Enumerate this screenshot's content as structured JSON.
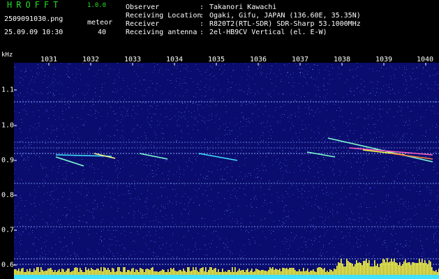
{
  "app": {
    "title": "HROFFT",
    "version": "1.0.0",
    "file_name": "2509091030.png",
    "timestamp": "25.09.09 10:30",
    "meteor_label": "meteor",
    "meteor_count": "40"
  },
  "info": [
    {
      "key": "Observer",
      "value": "Takanori Kawachi"
    },
    {
      "key": "Receiving Location",
      "value": "Ogaki, Gifu, JAPAN (136.60E, 35.35N)"
    },
    {
      "key": "Receiver",
      "value": "R820T2(RTL-SDR) SDR-Sharp 53.1000MHz"
    },
    {
      "key": "Receiving antenna",
      "value": "2el-HB9CV Vertical (el. E-W)"
    }
  ],
  "axis": {
    "y_unit": "kHz",
    "x_ticks": [
      "1031",
      "1032",
      "1033",
      "1034",
      "1035",
      "1036",
      "1037",
      "1038",
      "1039",
      "1040"
    ],
    "y_ticks": [
      "1.1",
      "1.0",
      "0.9",
      "0.8",
      "0.7",
      "0.6"
    ]
  },
  "colors": {
    "background": "#0b0d6e",
    "title_green": "#22e022",
    "level_bar": "#ffff40",
    "baseline": "#40e0ff"
  }
}
